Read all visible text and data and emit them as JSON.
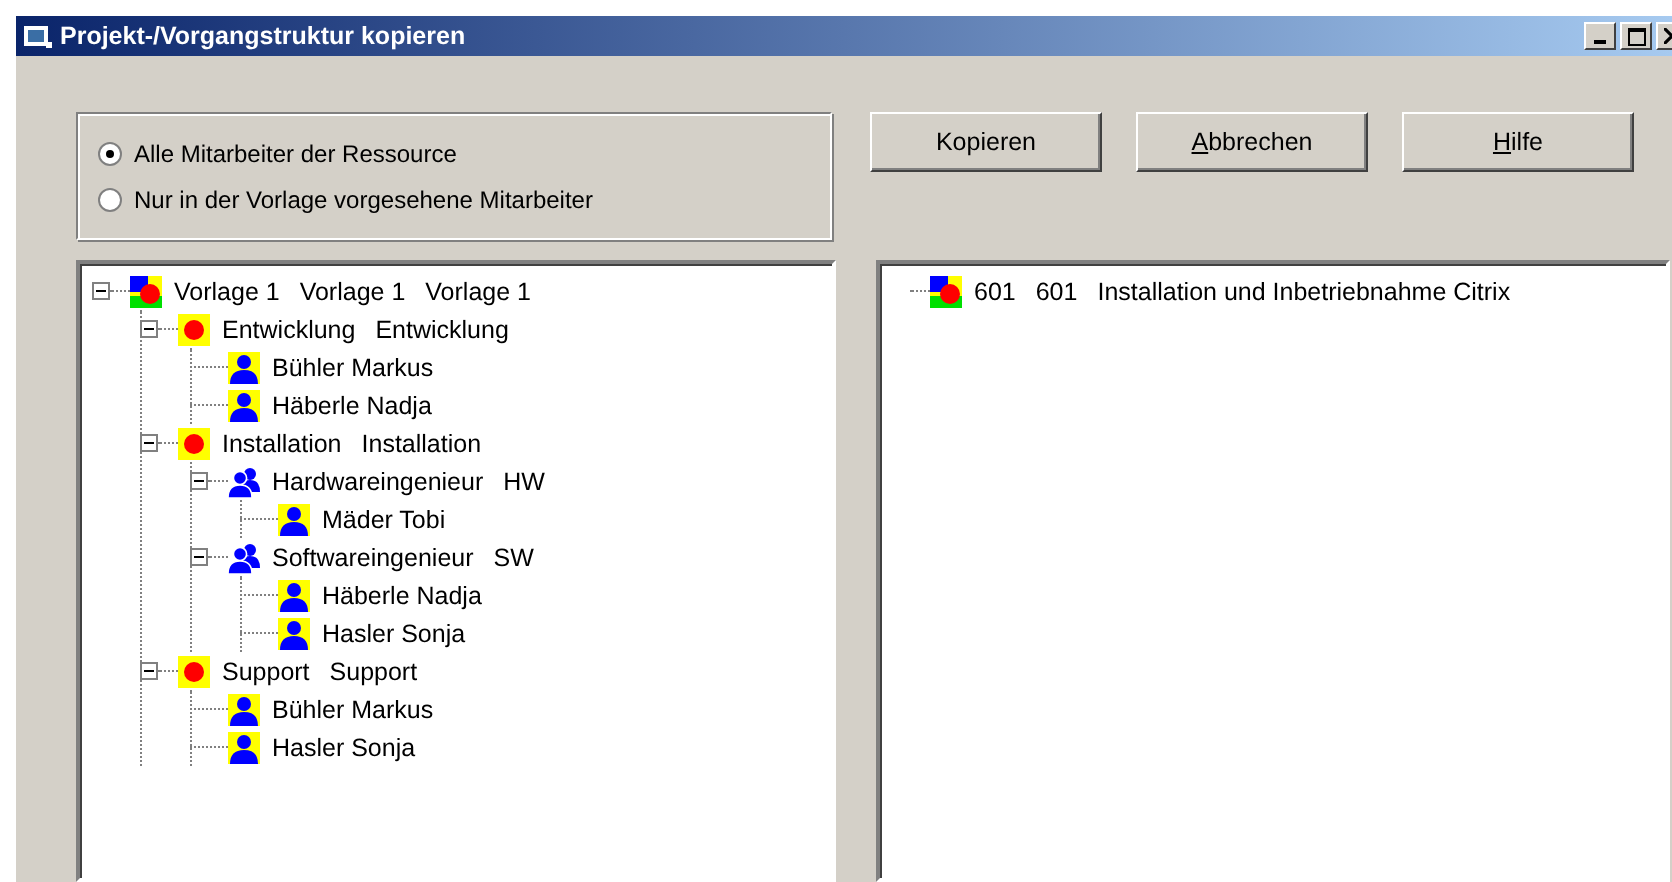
{
  "window": {
    "title": "Projekt-/Vorgangstruktur kopieren"
  },
  "options": [
    {
      "label": "Alle Mitarbeiter der Ressource",
      "selected": true
    },
    {
      "label": "Nur in der Vorlage vorgesehene Mitarbeiter",
      "selected": false
    }
  ],
  "buttons": [
    {
      "label": "Kopieren"
    },
    {
      "label": "Abbrechen",
      "first_letter_underlined": true
    },
    {
      "label": "Hilfe",
      "first_letter_underlined": true
    }
  ],
  "source_tree": [
    {
      "kind": "template",
      "texts": [
        "Vorlage 1",
        "Vorlage 1",
        "Vorlage 1"
      ],
      "expanded": true,
      "children": [
        {
          "kind": "group",
          "texts": [
            "Entwicklung",
            "Entwicklung"
          ],
          "expanded": true,
          "children": [
            {
              "kind": "person",
              "texts": [
                "Bühler Markus"
              ]
            },
            {
              "kind": "person",
              "texts": [
                "Häberle Nadja"
              ]
            }
          ]
        },
        {
          "kind": "group",
          "texts": [
            "Installation",
            "Installation"
          ],
          "expanded": true,
          "children": [
            {
              "kind": "role",
              "texts": [
                "Hardwareingenieur",
                "HW"
              ],
              "expanded": true,
              "children": [
                {
                  "kind": "person",
                  "texts": [
                    "Mäder Tobi"
                  ]
                }
              ]
            },
            {
              "kind": "role",
              "texts": [
                "Softwareingenieur",
                "SW"
              ],
              "expanded": true,
              "children": [
                {
                  "kind": "person",
                  "texts": [
                    "Häberle Nadja"
                  ]
                },
                {
                  "kind": "person",
                  "texts": [
                    "Hasler Sonja"
                  ]
                }
              ]
            }
          ]
        },
        {
          "kind": "group",
          "texts": [
            "Support",
            "Support"
          ],
          "expanded": true,
          "children": [
            {
              "kind": "person",
              "texts": [
                "Bühler Markus"
              ]
            },
            {
              "kind": "person",
              "texts": [
                "Hasler Sonja"
              ]
            }
          ]
        }
      ]
    }
  ],
  "target_tree": [
    {
      "kind": "template",
      "texts": [
        "601",
        "601",
        "Installation und Inbetriebnahme Citrix"
      ]
    }
  ]
}
